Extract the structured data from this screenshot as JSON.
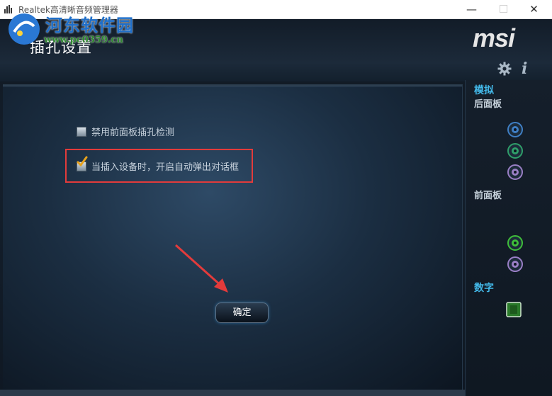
{
  "window": {
    "title": "Realtek高清晰音频管理器",
    "minimize_label": "—",
    "maximize_label": "☐",
    "close_label": "✕"
  },
  "watermark": {
    "name": "河东软件园",
    "url": "www.pc0359.cn"
  },
  "header": {
    "title": "插孔设置",
    "brand": "msi"
  },
  "options": [
    {
      "label": "禁用前面板插孔检测",
      "checked": false
    },
    {
      "label": "当插入设备时，开启自动弹出对话框",
      "checked": true
    }
  ],
  "ok_button": {
    "label": "确定"
  },
  "sidebar": {
    "analog_label": "模拟",
    "rear_panel_label": "后面板",
    "front_panel_label": "前面板",
    "digital_label": "数字",
    "rear_jacks": [
      {
        "color": "#3f7fc4",
        "name": "line-in-jack"
      },
      {
        "color": "#2f9f6a",
        "name": "line-out-jack"
      },
      {
        "color": "#9a7fc6",
        "name": "mic-jack"
      }
    ],
    "front_jacks": [
      {
        "color": "#3fbf3a",
        "name": "headphone-jack"
      },
      {
        "color": "#9a7fc6",
        "name": "mic-jack"
      }
    ]
  },
  "colors": {
    "accent": "#43b8e8",
    "highlight_box": "#e33b3b",
    "arrow": "#e33b3b"
  }
}
